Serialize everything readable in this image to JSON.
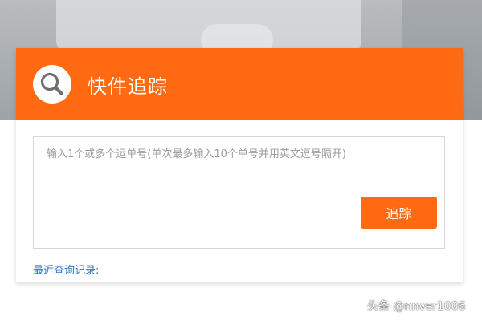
{
  "colors": {
    "accent": "#ff6a13",
    "link": "#2f76c2"
  },
  "header": {
    "icon": "search-icon",
    "title": "快件追踪"
  },
  "tracking": {
    "placeholder": "输入1个或多个运单号(单次最多输入10个单号并用英文逗号隔开)",
    "value": "",
    "button_label": "追踪"
  },
  "recent": {
    "label": "最近查询记录:"
  },
  "watermark": {
    "text": "头条 @nnver1006"
  }
}
